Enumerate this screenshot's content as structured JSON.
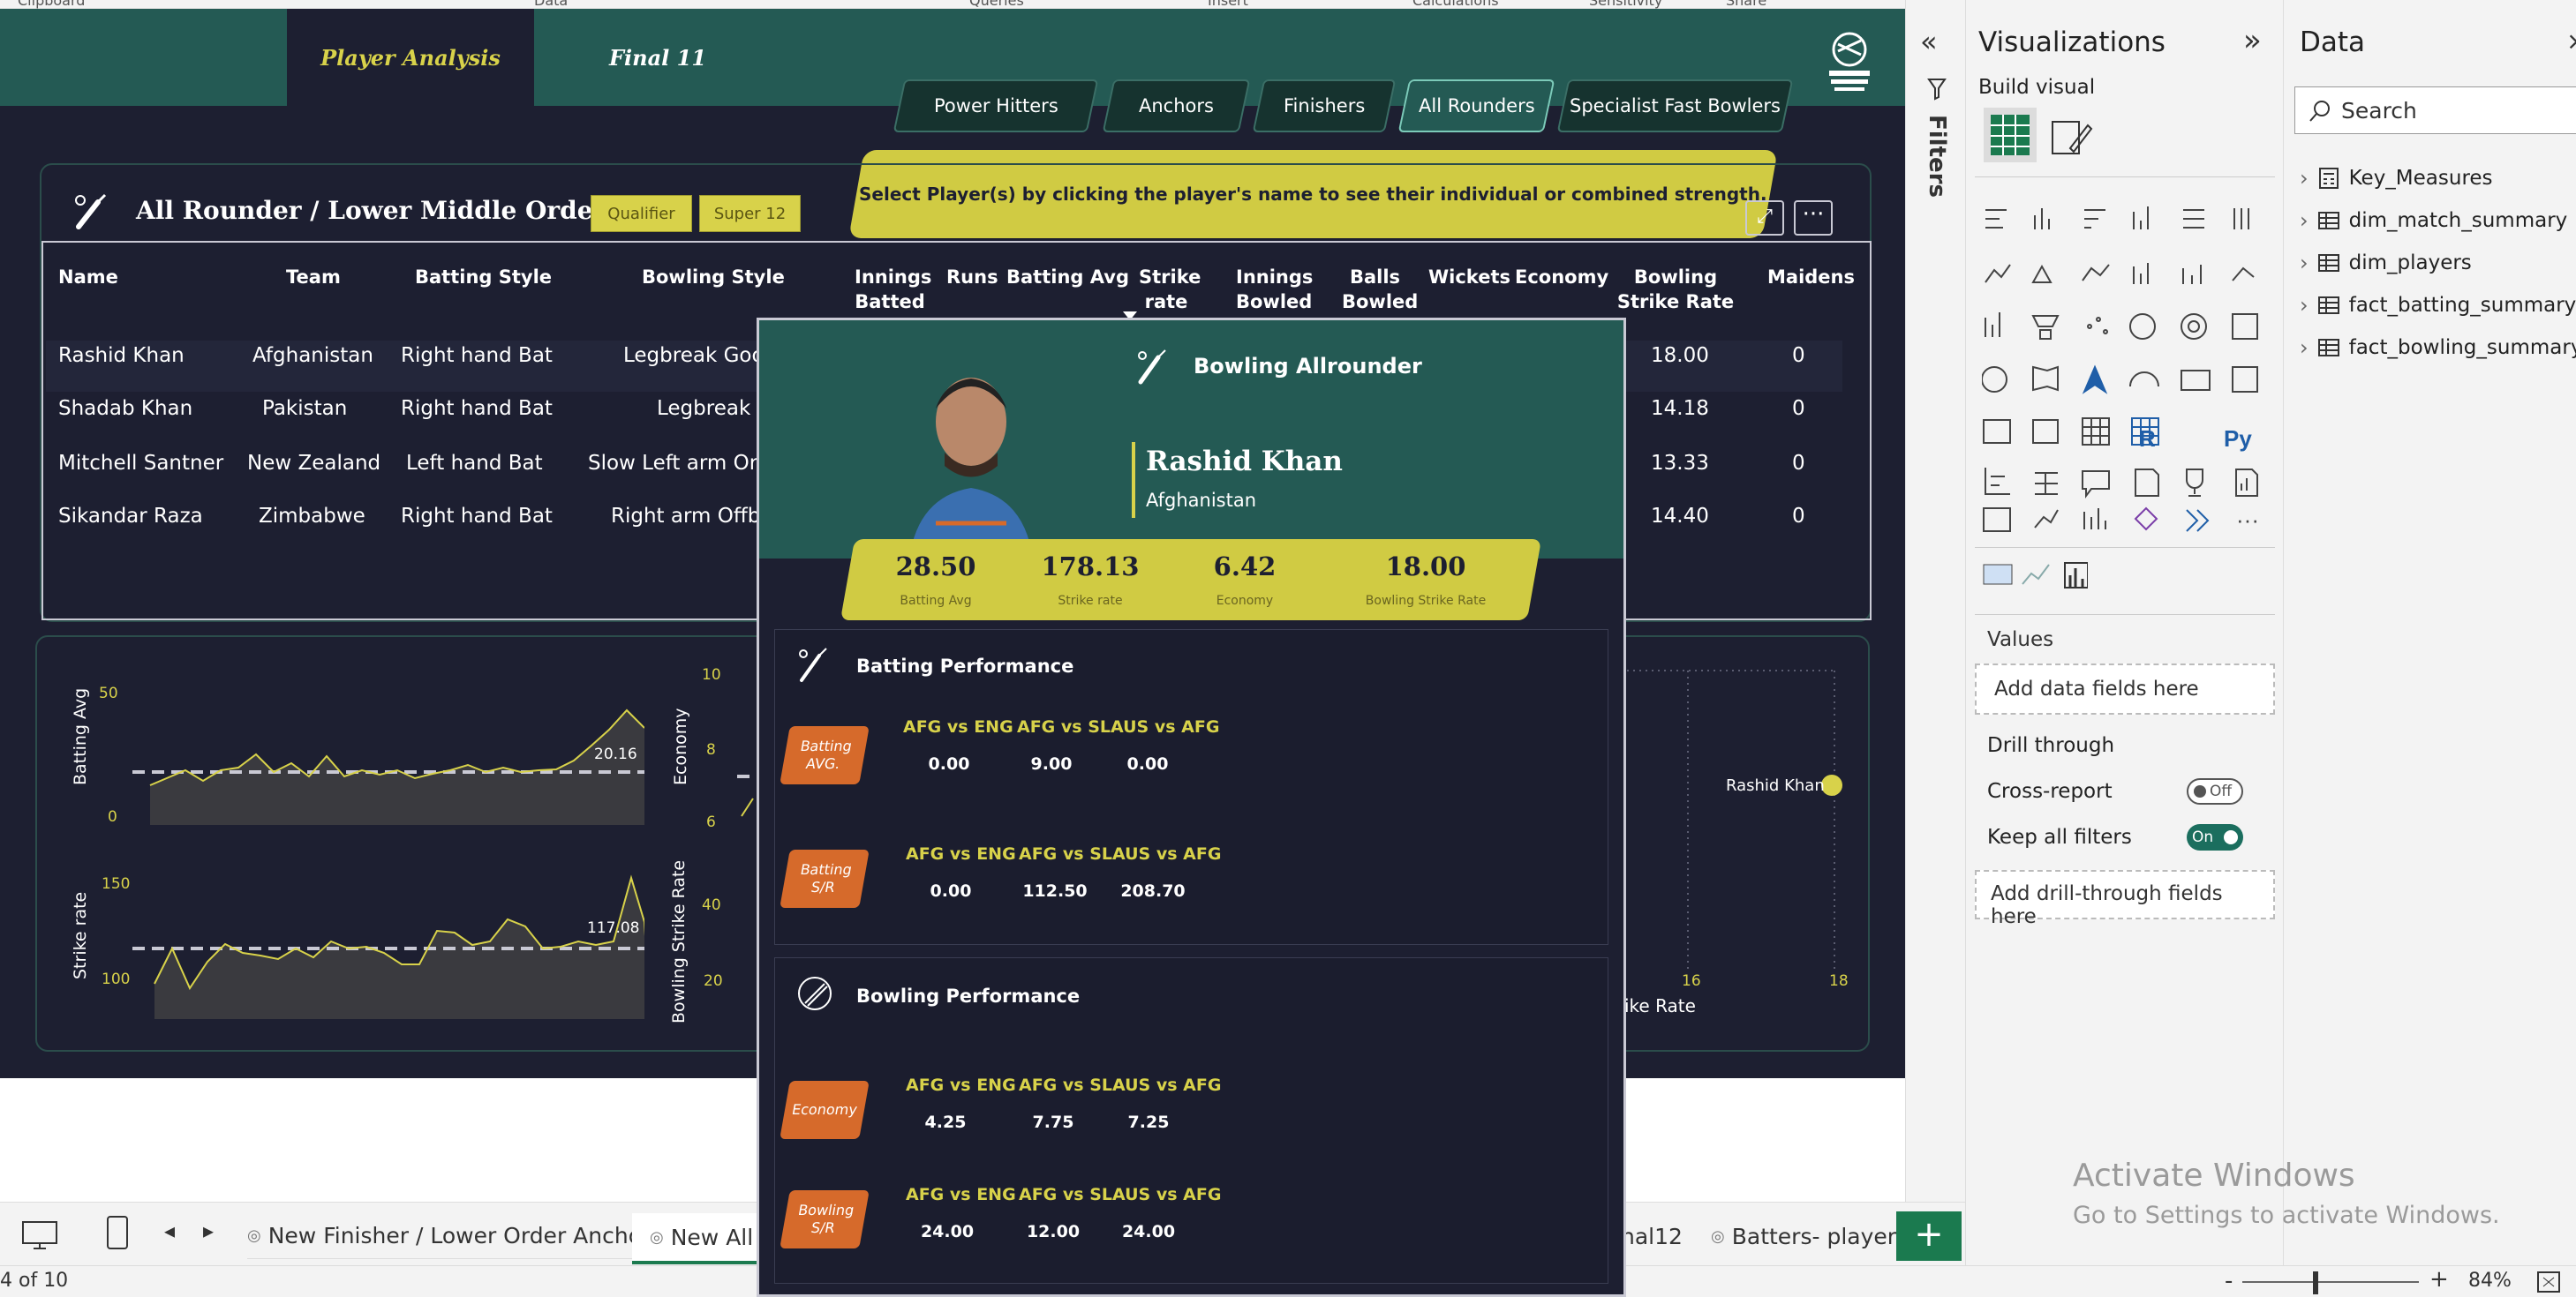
{
  "ribbon": {
    "groups": [
      "Clipboard",
      "Data",
      "Queries",
      "Insert",
      "Calculations",
      "Sensitivity",
      "Share"
    ]
  },
  "report": {
    "nav": {
      "tab1": "Player Analysis",
      "tab2": "Final 11"
    },
    "categories": [
      "Power Hitters",
      "Anchors",
      "Finishers",
      "All Rounders",
      "Specialist Fast Bowlers"
    ],
    "active_category": "All Rounders",
    "banner": "Select Player(s) by clicking the player's name to see their individual or combined strength.",
    "panel_title": "All Rounder / Lower Middle Order",
    "stage_filters": [
      "Qualifier",
      "Super 12"
    ],
    "columns": [
      "Name",
      "Team",
      "Batting Style",
      "Bowling Style",
      "Innings Batted",
      "Runs",
      "Batting Avg",
      "Strike rate",
      "Innings Bowled",
      "Balls Bowled",
      "Wickets",
      "Economy",
      "Bowling Strike Rate",
      "Maidens"
    ],
    "rows": [
      {
        "name": "Rashid Khan",
        "team": "Afghanistan",
        "batting": "Right hand Bat",
        "bowling": "Legbreak Goog",
        "bsr": "18.00",
        "maidens": "0"
      },
      {
        "name": "Shadab Khan",
        "team": "Pakistan",
        "batting": "Right hand Bat",
        "bowling": "Legbreak",
        "bsr": "14.18",
        "maidens": "0"
      },
      {
        "name": "Mitchell Santner",
        "team": "New Zealand",
        "batting": "Left hand Bat",
        "bowling": "Slow Left arm Orth",
        "bsr": "13.33",
        "maidens": "0"
      },
      {
        "name": "Sikandar Raza",
        "team": "Zimbabwe",
        "batting": "Right hand Bat",
        "bowling": "Right arm Offbr",
        "bsr": "14.40",
        "maidens": "0"
      }
    ],
    "charts": {
      "batting_avg": {
        "ylabel": "Batting Avg",
        "ticks": [
          "50",
          "0"
        ],
        "label": "20.16"
      },
      "strike_rate": {
        "ylabel": "Strike rate",
        "ticks": [
          "150",
          "100"
        ],
        "label": "117.08"
      },
      "economy": {
        "ylabel": "Economy",
        "ticks": [
          "10",
          "8",
          "6"
        ]
      },
      "bowling_sr": {
        "ylabel": "Bowling Strike Rate",
        "ticks": [
          "40",
          "20"
        ]
      },
      "scatter": {
        "xticks": [
          "16",
          "18"
        ],
        "xlabel_partial": "ike Rate",
        "point_label": "Rashid Khan"
      }
    }
  },
  "tooltip": {
    "role": "Bowling Allrounder",
    "player": "Rashid Khan",
    "country": "Afghanistan",
    "stats": [
      {
        "value": "28.50",
        "label": "Batting Avg"
      },
      {
        "value": "178.13",
        "label": "Strike rate"
      },
      {
        "value": "6.42",
        "label": "Economy"
      },
      {
        "value": "18.00",
        "label": "Bowling Strike Rate"
      }
    ],
    "batting_title": "Batting Performance",
    "bowling_title": "Bowling Performance",
    "matches": [
      "AFG vs ENG",
      "AFG vs SL",
      "AUS vs AFG"
    ],
    "batting_avg": {
      "badge_l1": "Batting",
      "badge_l2": "AVG.",
      "values": [
        "0.00",
        "9.00",
        "0.00"
      ]
    },
    "batting_sr": {
      "badge_l1": "Batting",
      "badge_l2": "S/R",
      "values": [
        "0.00",
        "112.50",
        "208.70"
      ]
    },
    "economy": {
      "badge_l1": "Economy",
      "badge_l2": "",
      "values": [
        "4.25",
        "7.75",
        "7.25"
      ]
    },
    "bowling_sr": {
      "badge_l1": "Bowling",
      "badge_l2": "S/R",
      "values": [
        "24.00",
        "12.00",
        "24.00"
      ]
    }
  },
  "filters_label": "Filters",
  "viz_pane": {
    "title": "Visualizations",
    "build_visual": "Build visual",
    "values_label": "Values",
    "values_placeholder": "Add data fields here",
    "drill_title": "Drill through",
    "cross_report": "Cross-report",
    "cross_report_state": "Off",
    "keep_filters": "Keep all filters",
    "keep_filters_state": "On",
    "drill_placeholder": "Add drill-through fields here"
  },
  "data_pane": {
    "title": "Data",
    "search_placeholder": "Search",
    "tables": [
      "Key_Measures",
      "dim_match_summary",
      "dim_players",
      "fact_batting_summary",
      "fact_bowling_summary"
    ]
  },
  "tabs": [
    "New Finisher / Lower Order Anchor",
    "New All",
    "nal12",
    "Batters- player c"
  ],
  "status": {
    "page": "4 of 10",
    "zoom": "84%"
  },
  "watermark": {
    "title": "Activate Windows",
    "subtitle": "Go to Settings to activate Windows."
  },
  "colors": {
    "accent_yellow": "#d8d24a",
    "teal": "#245a54",
    "navy": "#1d1f31",
    "badge_orange": "#d66a2b",
    "add_page_green": "#1b7a4f"
  }
}
